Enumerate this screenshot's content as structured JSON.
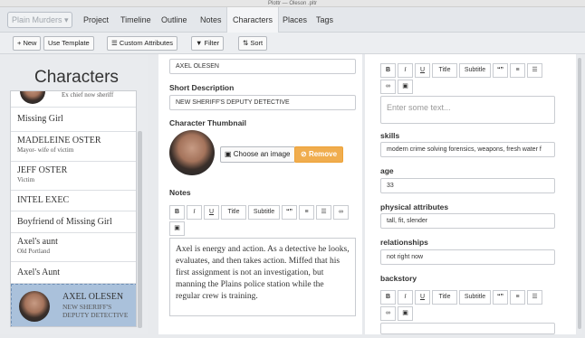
{
  "window": {
    "title": "Plottr — Oleson .pltr"
  },
  "menubar": {
    "book": "Plain Murders",
    "tabs": [
      "Project",
      "Timeline",
      "Outline",
      "Notes",
      "Characters",
      "Places",
      "Tags"
    ],
    "active_tab": "Characters"
  },
  "toolbar": {
    "new_label": "+ New",
    "template_label": "Use Template",
    "custom_attr_label": "Custom Attributes",
    "filter_label": "Filter",
    "sort_label": "Sort"
  },
  "left_panel": {
    "title": "Characters",
    "partial_top": {
      "sub": "Ex chief now sheriff"
    },
    "characters": [
      {
        "name": "Missing Girl",
        "description": ""
      },
      {
        "name": "MADELEINE OSTER",
        "description": "Mayor- wife of victim"
      },
      {
        "name": "JEFF OSTER",
        "description": "Victim"
      },
      {
        "name": "INTEL EXEC",
        "description": ""
      },
      {
        "name": "Boyfriend of Missing Girl",
        "description": ""
      },
      {
        "name": "Axel's aunt",
        "description": "Old Portland"
      },
      {
        "name": "Axel's Aunt",
        "description": ""
      }
    ],
    "selected": {
      "name": "AXEL OLESEN",
      "description_line1": "NEW SHERIFF'S",
      "description_line2": "DEPUTY DETECTIVE"
    }
  },
  "editor": {
    "name_value": "AXEL OLESEN",
    "short_desc_label": "Short Description",
    "short_desc_value": "NEW SHERIFF'S DEPUTY DETECTIVE",
    "thumbnail_label": "Character Thumbnail",
    "choose_image": "Choose an image",
    "remove": "Remove",
    "notes_label": "Notes",
    "rte_buttons": [
      "B",
      "I",
      "U",
      "Title",
      "Subtitle",
      "“”",
      "≡",
      "☰",
      "🔗"
    ],
    "notes_text": "Axel is energy and action. As a detective he looks, evaluates, and then takes action. Miffed that his first assignment is not an investigation, but manning the Plains police station while the regular crew is training."
  },
  "attributes": {
    "description_placeholder": "Enter some text...",
    "skills_label": "skills",
    "skills_value": "modern crime solving forensics, weapons, fresh water f",
    "age_label": "age",
    "age_value": "33",
    "physical_label": "physical attributes",
    "physical_value": "tall, fit, slender",
    "relationships_label": "relationships",
    "relationships_value": "not right now",
    "backstory_label": "backstory"
  }
}
